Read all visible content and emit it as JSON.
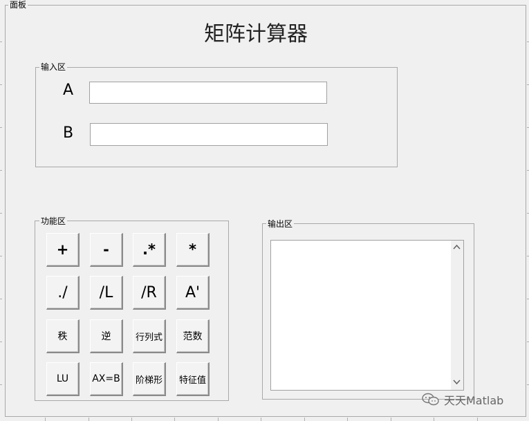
{
  "panel": {
    "legend": "面板"
  },
  "title": "矩阵计算器",
  "input_area": {
    "legend": "输入区",
    "a_label": "A",
    "b_label": "B",
    "a_value": "",
    "b_value": ""
  },
  "func_area": {
    "legend": "功能区",
    "buttons": [
      "+",
      "-",
      ".*",
      "*",
      "./",
      "/L",
      "/R",
      "A'",
      "秩",
      "逆",
      "行列式",
      "范数",
      "LU",
      "AX=B",
      "阶梯形",
      "特征值"
    ]
  },
  "output_area": {
    "legend": "输出区",
    "value": ""
  },
  "watermark": {
    "text": "天天Matlab"
  },
  "icons": {
    "scroll_up": "chevron-up-icon",
    "scroll_down": "chevron-down-icon",
    "wechat": "wechat-icon"
  }
}
